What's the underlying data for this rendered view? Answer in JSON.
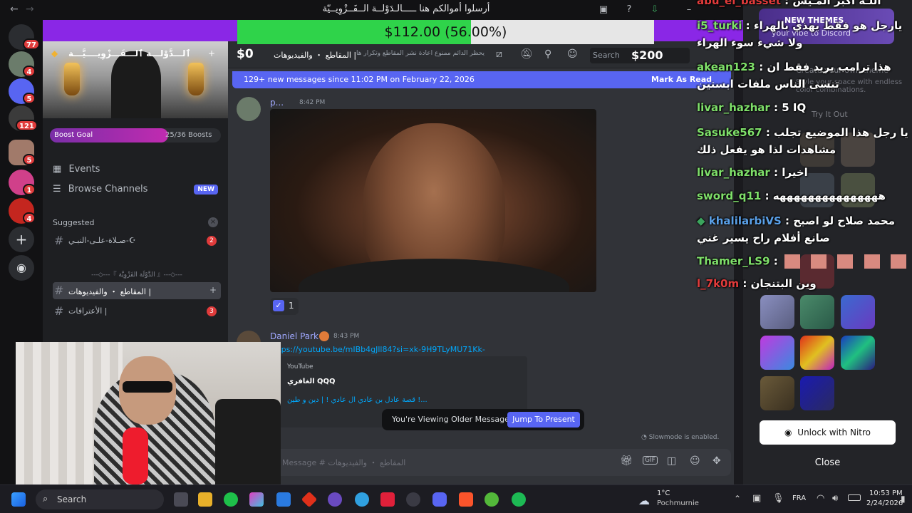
{
  "window": {
    "title": "أرسلوا أموالكم هنا ـــــالـدَوْلــة الــفَــزْوِيــيّة"
  },
  "rail": {
    "badges": [
      "77",
      "4",
      "5",
      "121",
      "5",
      "1",
      "4"
    ]
  },
  "server": {
    "name": "ٱلـــدَّوْلـــة ٱلـــفَـــزْوِيــــيَّـــة",
    "boost_label": "Boost Goal",
    "boost_count": "25/36 Boosts",
    "boost_fraction": 0.69
  },
  "sidebar": {
    "events": "Events",
    "browse": "Browse Channels",
    "browse_badge": "NEW",
    "suggested": "Suggested",
    "suggested_channel": "صـلاة-علـى-النبـي-☪",
    "suggested_count": "2",
    "category": "---◇---『 الدَّوْلَة الفَزْوِيَّة 』---◇---",
    "channels": [
      {
        "label": "المقاطع ・ والفيديوهات |",
        "badge": ""
      },
      {
        "label": "الأعترافات |",
        "badge": "3"
      }
    ]
  },
  "chat": {
    "header_channel": "المقاطع ・ والفيديوهات |",
    "header_topic": "يحظر الدائم ممنوع اعادة نشر المقاطع وتكرار ها",
    "search_placeholder": "Search",
    "dollar_left": "$0",
    "dollar_right": "$200",
    "new_messages": "129+ new messages since 11:02 PM on February 22, 2026",
    "mark_as_read": "Mark As Read",
    "msg1_author": "p...",
    "msg1_time": "8:42 PM",
    "reaction_count": "1",
    "msg2_author": "Daniel Park",
    "msg2_time": "8:43 PM",
    "msg2_link": "https://youtube.be/mIBb4gJll84?si=xk-9H9TLyMU71Kk-",
    "embed_provider": "YouTube",
    "embed_author": "الغافري QQQ",
    "embed_title": "قصة عادل بن عادي ال عادي ! | دين و طين !...",
    "older_notice": "You're Viewing Older Messages",
    "jump_label": "Jump To Present",
    "slowmode": "Slowmode is enabled.",
    "composer_placeholder": "Message # المقاطع ・ والفيديوهات"
  },
  "donation": {
    "amount": "$112.00 (56.00%)",
    "fraction": 0.56
  },
  "overlay_chat": [
    {
      "user": "abu_el_basset",
      "msg": "اللـه اكبر المـيس",
      "color": "#e23b3b"
    },
    {
      "user": "i5_turki",
      "msg": "يارجل هو فقط يهذي بالهراء ولا شيء سوء الهراء",
      "color": "#7fe06a"
    },
    {
      "user": "akean123",
      "msg": "هذا ترامب يريد فقط ان تنسى الناس ملفات ابستين",
      "color": "#7fe06a"
    },
    {
      "user": "livar_hazhar",
      "msg": "5 IQ",
      "color": "#7fe06a"
    },
    {
      "user": "Sasuke567",
      "msg": "يا رجل هذا الموضيع تجلب مشاهدات لذا هو يفعل ذلك",
      "color": "#7fe06a"
    },
    {
      "user": "livar_hazhar",
      "msg": "اخيرا",
      "color": "#7fe06a"
    },
    {
      "user": "sword_q11",
      "msg": "هههههههههههههههه",
      "color": "#7fe06a"
    },
    {
      "user": "khalilarbiVS",
      "msg": "محمد صلاح لو اصبح صانع أفلام راح يسير غني",
      "color": "#5aa0e8"
    },
    {
      "user": "Thamer_LS9",
      "msg": "",
      "color": "#7fe06a"
    },
    {
      "user": "l_7k0m",
      "msg": "وين البتنجان",
      "color": "#e23b3b"
    }
  ],
  "nitro": {
    "promo_title": "NEW THEMES",
    "promo_sub": "your vibe to Discord",
    "create_title": "Create your own theme",
    "create_sub": "Style your space with endless color combinations.",
    "try_it": "Try It Out",
    "unlock": "Unlock with Nitro",
    "close": "Close"
  },
  "taskbar": {
    "search": "Search",
    "weather_temp": "1°C",
    "weather_loc": "Pochmurnie",
    "lang": "FRA",
    "time": "10:53 PM",
    "date": "2/24/2026"
  }
}
